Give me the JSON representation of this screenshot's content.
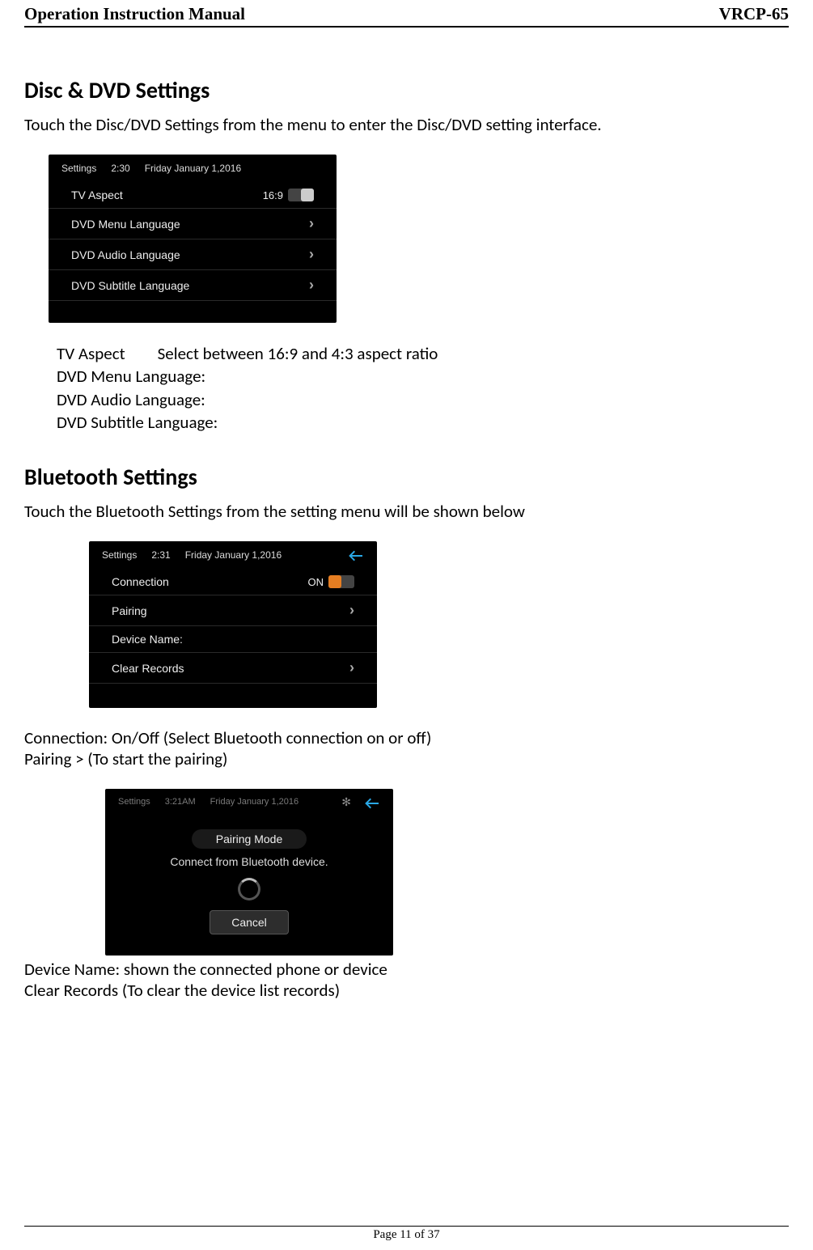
{
  "header": {
    "left": "Operation Instruction Manual",
    "right": "VRCP-65"
  },
  "footer": {
    "text": "Page 11 of 37"
  },
  "section1": {
    "title": "Disc & DVD Settings",
    "intro": "Touch the Disc/DVD Settings from the menu to enter the Disc/DVD setting interface.",
    "list": {
      "tvaspect_label": "TV Aspect",
      "tvaspect_desc": "Select between 16:9 and 4:3 aspect ratio",
      "menu_lang": "DVD Menu Language:",
      "audio_lang": "DVD Audio Language:",
      "subtitle_lang": "DVD Subtitle Language:"
    }
  },
  "shot1": {
    "header": {
      "app": "Settings",
      "time": "2:30",
      "date": "Friday January 1,2016"
    },
    "rows": [
      {
        "label": "TV Aspect",
        "value": "16:9",
        "type": "toggle"
      },
      {
        "label": "DVD Menu Language",
        "type": "chevron"
      },
      {
        "label": "DVD Audio Language",
        "type": "chevron"
      },
      {
        "label": "DVD Subtitle Language",
        "type": "chevron"
      }
    ]
  },
  "section2": {
    "title": "Bluetooth Settings",
    "intro": "Touch the Bluetooth Settings from the setting menu will be shown below",
    "after1_line1": "Connection: On/Off (Select Bluetooth connection on or off)",
    "after1_line2": "Pairing > (To start the pairing)",
    "after2_line1": "Device Name: shown the connected phone or device",
    "after2_line2": "Clear Records (To clear the device list records)"
  },
  "shot2": {
    "header": {
      "app": "Settings",
      "time": "2:31",
      "date": "Friday January 1,2016"
    },
    "rows": [
      {
        "label": "Connection",
        "value": "ON",
        "type": "toggle-on"
      },
      {
        "label": "Pairing",
        "type": "chevron"
      },
      {
        "label": "Device Name:",
        "type": "none"
      },
      {
        "label": "Clear Records",
        "type": "chevron"
      }
    ]
  },
  "shot3": {
    "header": {
      "app": "Settings",
      "time": "3:21AM",
      "date": "Friday January 1,2016"
    },
    "dialog": {
      "title": "Pairing Mode",
      "message": "Connect from Bluetooth device.",
      "cancel": "Cancel"
    }
  }
}
